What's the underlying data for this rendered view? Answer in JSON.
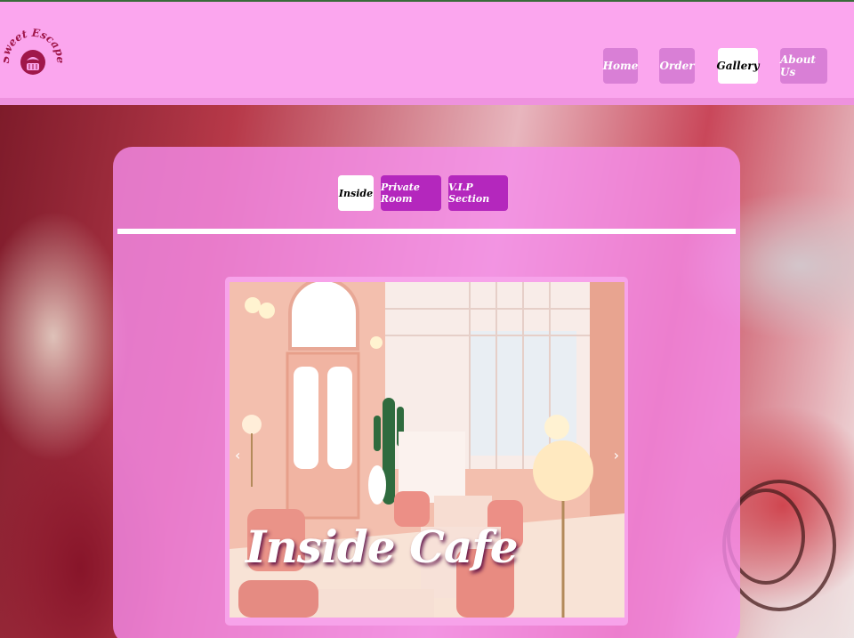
{
  "brand": {
    "name": "Sweet Escape"
  },
  "nav": {
    "items": [
      {
        "label": "Home",
        "active": false
      },
      {
        "label": "Order",
        "active": false
      },
      {
        "label": "Gallery",
        "active": true
      },
      {
        "label": "About Us",
        "active": false
      }
    ]
  },
  "gallery": {
    "tabs": [
      {
        "label": "Inside",
        "active": true
      },
      {
        "label": "Private Room",
        "active": false
      },
      {
        "label": "V.I.P Section",
        "active": false
      }
    ],
    "slide": {
      "caption": "Inside Cafe",
      "prev_icon": "‹",
      "next_icon": "›"
    }
  },
  "colors": {
    "header": "#fba6ee",
    "nav_button": "#d97fd6",
    "tab_button": "#b427bd",
    "panel": "#f58ceb"
  }
}
